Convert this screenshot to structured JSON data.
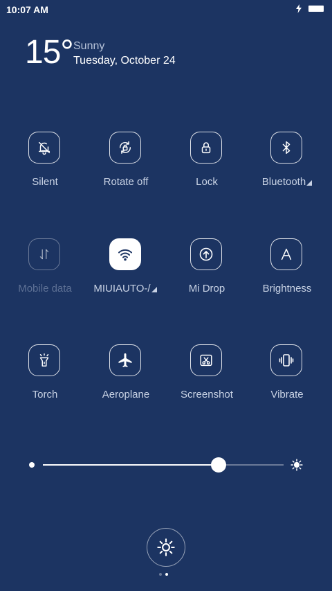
{
  "status_bar": {
    "time": "10:07 AM",
    "icons": [
      "charging-icon",
      "battery-icon"
    ]
  },
  "weather": {
    "temperature": "15°",
    "condition": "Sunny",
    "date": "Tuesday, October 24"
  },
  "toggles": [
    {
      "label": "Silent",
      "icon": "bell-off-icon",
      "state": "off"
    },
    {
      "label": "Rotate off",
      "icon": "rotate-lock-icon",
      "state": "off"
    },
    {
      "label": "Lock",
      "icon": "lock-icon",
      "state": "off"
    },
    {
      "label": "Bluetooth",
      "icon": "bluetooth-icon",
      "state": "off",
      "has_menu": true
    },
    {
      "label": "Mobile data",
      "icon": "mobile-data-icon",
      "state": "disabled"
    },
    {
      "label": "MIUIAUTO-/",
      "icon": "wifi-icon",
      "state": "on",
      "has_menu": true
    },
    {
      "label": "Mi Drop",
      "icon": "mi-drop-icon",
      "state": "off"
    },
    {
      "label": "Brightness",
      "icon": "auto-brightness-icon",
      "state": "off"
    },
    {
      "label": "Torch",
      "icon": "torch-icon",
      "state": "off"
    },
    {
      "label": "Aeroplane",
      "icon": "airplane-icon",
      "state": "off"
    },
    {
      "label": "Screenshot",
      "icon": "screenshot-icon",
      "state": "off"
    },
    {
      "label": "Vibrate",
      "icon": "vibrate-icon",
      "state": "off"
    }
  ],
  "brightness": {
    "level": 0.73
  },
  "pager": {
    "pages": 2,
    "current": 2
  },
  "colors": {
    "background": "#1c3462",
    "label": "#c8d2e4",
    "label_disabled": "#5d7094",
    "accent": "#ffffff"
  }
}
